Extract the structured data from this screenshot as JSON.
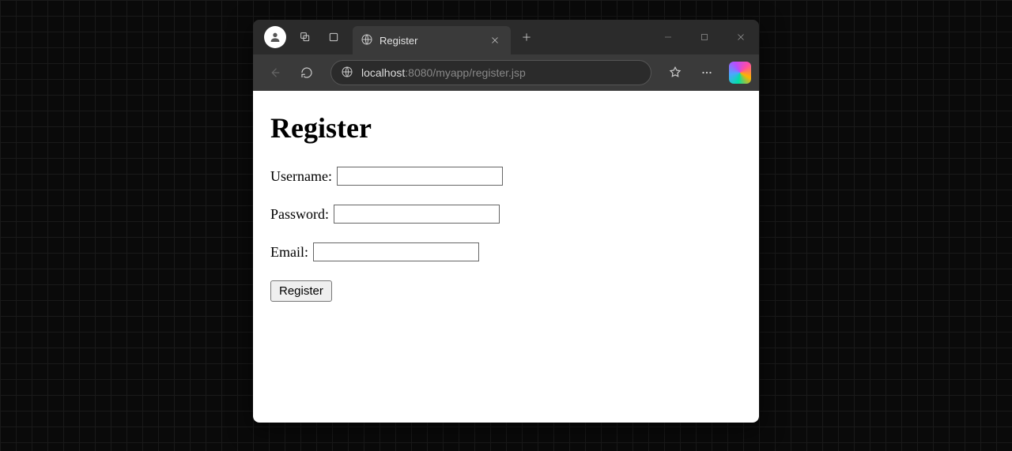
{
  "browser": {
    "tab_title": "Register",
    "url_host": "localhost",
    "url_port_path": ":8080/myapp/register.jsp"
  },
  "page": {
    "heading": "Register",
    "fields": {
      "username": {
        "label": "Username:",
        "value": ""
      },
      "password": {
        "label": "Password:",
        "value": ""
      },
      "email": {
        "label": "Email:",
        "value": ""
      }
    },
    "submit_label": "Register"
  }
}
